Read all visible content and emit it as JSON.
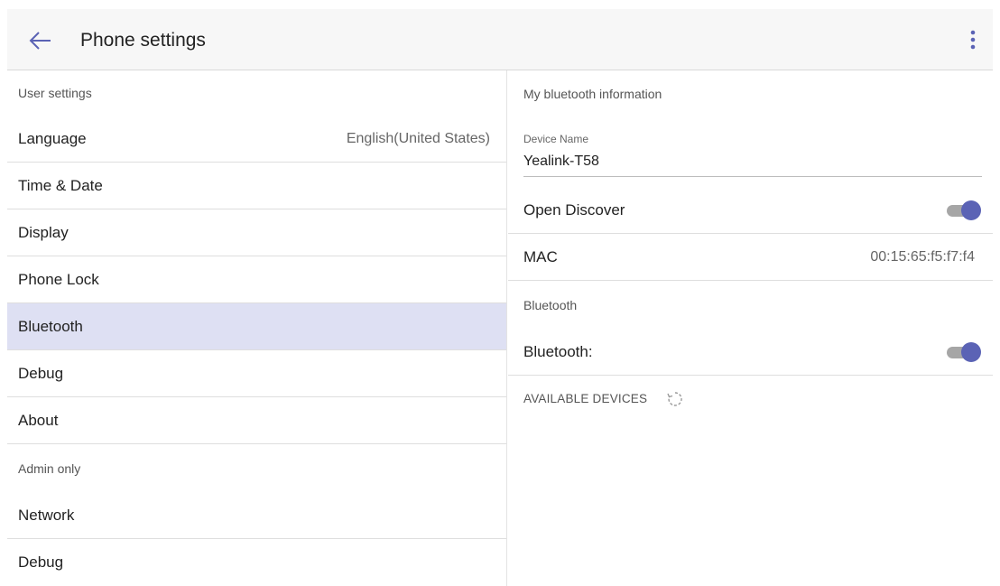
{
  "header": {
    "title": "Phone settings",
    "back_icon": "arrow-left-icon",
    "menu_icon": "more-vert-icon"
  },
  "left": {
    "user_section": "User settings",
    "items": [
      {
        "label": "Language",
        "value": "English(United States)"
      },
      {
        "label": "Time & Date"
      },
      {
        "label": "Display"
      },
      {
        "label": "Phone Lock"
      },
      {
        "label": "Bluetooth",
        "active": true
      },
      {
        "label": "Debug"
      },
      {
        "label": "About"
      }
    ],
    "admin_section": "Admin only",
    "admin_items": [
      {
        "label": "Network"
      },
      {
        "label": "Debug"
      }
    ]
  },
  "right": {
    "info_section": "My bluetooth information",
    "device_name_label": "Device Name",
    "device_name_value": "Yealink-T58",
    "open_discover": {
      "label": "Open Discover",
      "on": true
    },
    "mac": {
      "label": "MAC",
      "value": "00:15:65:f5:f7:f4"
    },
    "bluetooth_section": "Bluetooth",
    "bluetooth_toggle": {
      "label": "Bluetooth:",
      "on": true
    },
    "available_devices": "AVAILABLE DEVICES",
    "spinner_icon": "refresh-spinner-icon"
  },
  "colors": {
    "accent": "#5b63b5",
    "active_row": "#dee0f3",
    "header_bg": "#f7f7f7",
    "toggle_track": "#a6a6a6"
  }
}
